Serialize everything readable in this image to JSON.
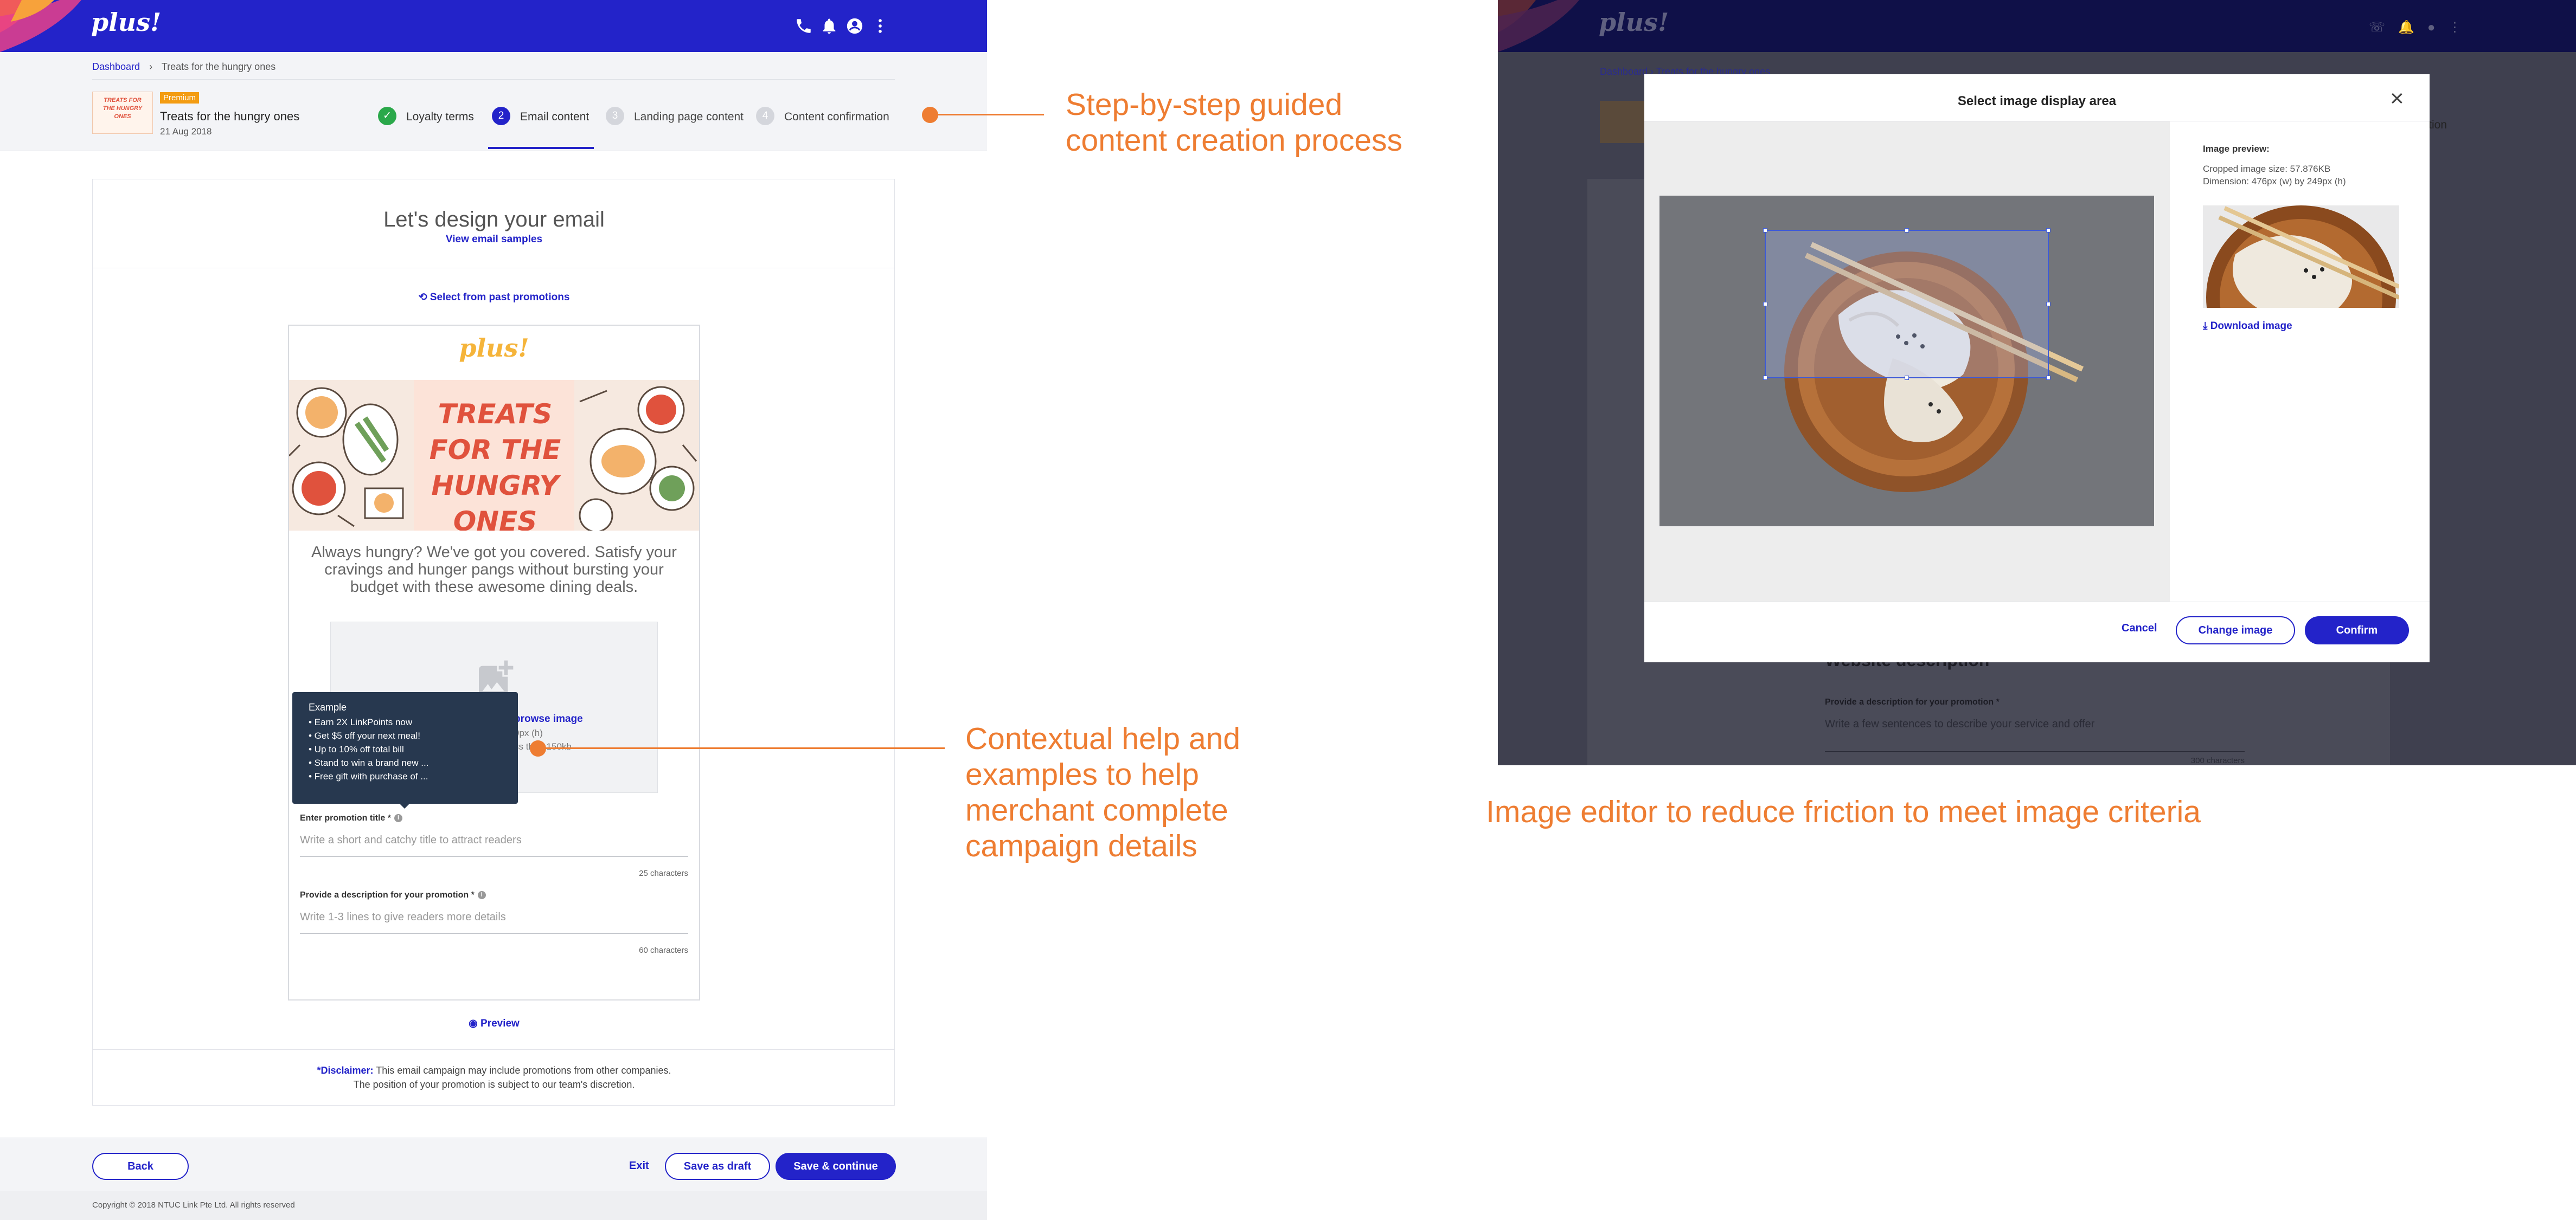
{
  "app": {
    "logo_text": "plus!"
  },
  "icons": {
    "phone": "phone-icon",
    "bell": "bell-icon",
    "account": "account-icon",
    "more": "more-vertical-icon",
    "check": "check-icon",
    "eye": "eye-icon",
    "download": "download-icon",
    "history": "history-icon",
    "close": "close-icon",
    "image": "image-placeholder-icon"
  },
  "colors": {
    "brand": "#2323c9",
    "annotation": "#ee7d32",
    "premium": "#f39c12"
  },
  "breadcrumb": {
    "home": "Dashboard",
    "separator": "›",
    "current": "Treats for the hungry ones"
  },
  "campaign": {
    "badge": "Premium",
    "name": "Treats for the hungry ones",
    "date": "21 Aug 2018",
    "thumb_text": "TREATS FOR THE HUNGRY ONES"
  },
  "stepper": {
    "steps": [
      {
        "num": "✓",
        "label": "Loyalty terms",
        "state": "done"
      },
      {
        "num": "2",
        "label": "Email content",
        "state": "active"
      },
      {
        "num": "3",
        "label": "Landing page content",
        "state": "todo"
      },
      {
        "num": "4",
        "label": "Content confirmation",
        "state": "todo"
      }
    ]
  },
  "editor": {
    "heading": "Let's design your email",
    "samples_link": "View email samples",
    "past_promos": "Select from past promotions",
    "email_logo": "plus!",
    "hero_text": "TREATS FOR THE HUNGRY ONES",
    "intro": "Always hungry? We've got you covered. Satisfy your cravings and hunger pangs without bursting your budget with these awesome dining deals.",
    "upload": {
      "link": "browse image",
      "line1": "9px (h)",
      "line2": "ss than 150kb"
    },
    "tooltip": {
      "title": "Example",
      "items": [
        "• Earn 2X LinkPoints now",
        "• Get $5 off your next meal!",
        "• Up to 10% off total bill",
        "• Stand to win a brand new ...",
        "• Free gift with purchase of ..."
      ]
    },
    "title_field": {
      "label": "Enter promotion title *",
      "placeholder": "Write a short and catchy title to attract readers",
      "counter": "25 characters"
    },
    "desc_field": {
      "label": "Provide a description for your promotion *",
      "placeholder": "Write 1-3 lines to give readers more details",
      "counter": "60 characters"
    },
    "preview": "Preview",
    "disclaimer_bold": "*Disclaimer:",
    "disclaimer_1": " This email campaign may include promotions from other companies.",
    "disclaimer_2": "The position of your promotion is subject to our team's discretion."
  },
  "footer": {
    "back": "Back",
    "exit": "Exit",
    "draft": "Save as draft",
    "continue": "Save & continue",
    "copyright": "Copyright © 2018 NTUC Link Pte Ltd. All rights reserved"
  },
  "modal": {
    "title": "Select image display area",
    "close": "×",
    "preview_label": "Image preview:",
    "size": "Cropped image size: 57.876KB",
    "dimension": "Dimension: 476px (w) by 249px (h)",
    "download": "Download image",
    "cancel": "Cancel",
    "change": "Change image",
    "confirm": "Confirm"
  },
  "background_right": {
    "crumb_home": "Dashboard",
    "crumb_current": "Treats for the hungry ones",
    "step_tail": "rmation",
    "section_title": "Website description",
    "field_label": "Provide a description for your promotion *",
    "field_ph": "Write a few sentences to describe your service and offer",
    "counter": "300 characters"
  },
  "annotations": {
    "a1_l1": "Step-by-step guided",
    "a1_l2": "content creation process",
    "a2_l1": "Contextual help and",
    "a2_l2": "examples to help",
    "a2_l3": "merchant complete",
    "a2_l4": "campaign details",
    "a3": "Image editor to reduce friction to meet image criteria"
  }
}
